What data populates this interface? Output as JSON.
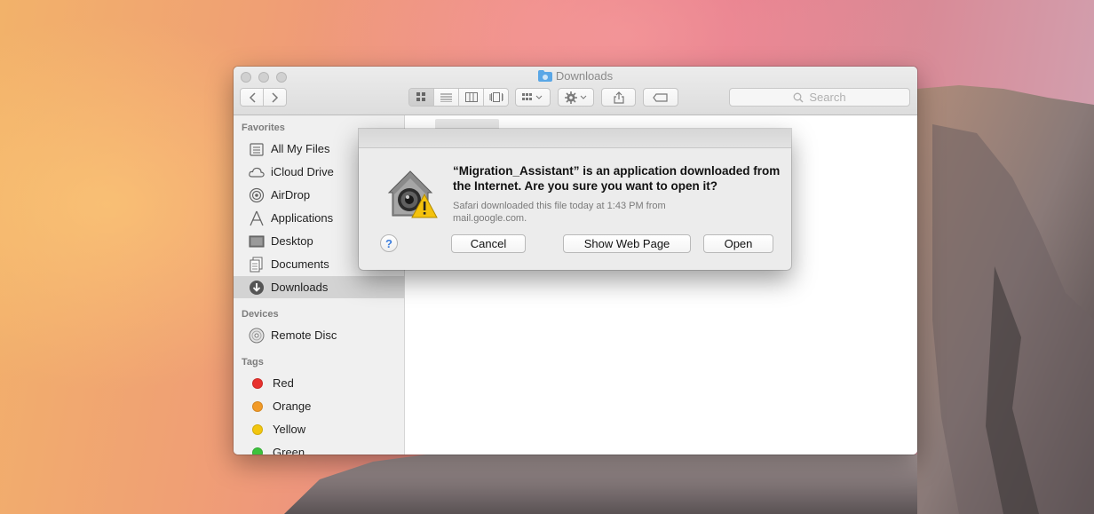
{
  "window": {
    "title": "Downloads",
    "search_placeholder": "Search",
    "toolbar_icons": [
      "back-icon",
      "forward-icon",
      "icon-view-icon",
      "list-view-icon",
      "column-view-icon",
      "cover-flow-icon",
      "arrange-icon",
      "action-gear-icon",
      "share-icon",
      "tag-icon"
    ]
  },
  "sidebar": {
    "favorites_header": "Favorites",
    "favorites": [
      {
        "label": "All My Files",
        "icon": "all-files-icon"
      },
      {
        "label": "iCloud Drive",
        "icon": "cloud-icon"
      },
      {
        "label": "AirDrop",
        "icon": "airdrop-icon"
      },
      {
        "label": "Applications",
        "icon": "applications-icon"
      },
      {
        "label": "Desktop",
        "icon": "desktop-icon"
      },
      {
        "label": "Documents",
        "icon": "documents-icon"
      },
      {
        "label": "Downloads",
        "icon": "downloads-icon",
        "selected": true
      }
    ],
    "devices_header": "Devices",
    "devices": [
      {
        "label": "Remote Disc",
        "icon": "disc-icon"
      }
    ],
    "tags_header": "Tags",
    "tags": [
      {
        "label": "Red",
        "color": "#e8312d"
      },
      {
        "label": "Orange",
        "color": "#f29a27"
      },
      {
        "label": "Yellow",
        "color": "#f2c60f"
      },
      {
        "label": "Green",
        "color": "#3cc23c"
      }
    ]
  },
  "dialog": {
    "title": "“Migration_Assistant” is an application downloaded from the Internet. Are you sure you want to open it?",
    "message": "Safari downloaded this file today at 1:43 PM from mail.google.com.",
    "help_label": "?",
    "cancel_label": "Cancel",
    "show_web_page_label": "Show Web Page",
    "open_label": "Open",
    "icon": "gatekeeper-warning-icon"
  }
}
